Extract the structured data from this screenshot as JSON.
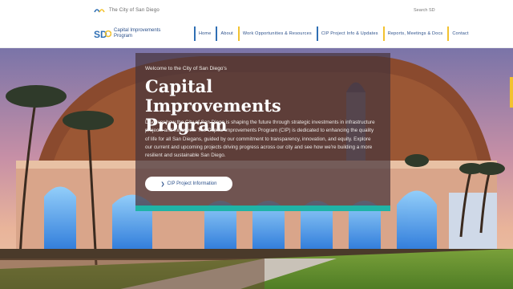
{
  "topbar": {
    "city_label": "The City of San Diego",
    "search_label": "Search SD"
  },
  "brand": {
    "mark": "SD",
    "name": "Capital Improvements Program"
  },
  "nav": [
    {
      "label": "Home"
    },
    {
      "label": "About"
    },
    {
      "label": "Work Opportunities & Resources"
    },
    {
      "label": "CIP Project Info & Updates"
    },
    {
      "label": "Reports, Meetings & Docs"
    },
    {
      "label": "Contact"
    }
  ],
  "hero": {
    "eyebrow": "Welcome to the City of San Diego's",
    "title": "Capital Improvements Program",
    "description": "Discover how the City of San Diego is shaping the future through strategic investments in infrastructure projects and initiatives. The Capital Improvements Program (CIP) is dedicated to enhancing the quality of life for all San Diegans, guided by our commitment to transparency, innovation, and equity. Explore our current and upcoming projects driving progress across our city and see how we're building a more resilient and sustainable San Diego.",
    "cta_label": "CIP Project Information"
  },
  "colors": {
    "accent_blue": "#2f6fb4",
    "accent_yellow": "#f2c230",
    "teal": "#1fb3a6"
  }
}
